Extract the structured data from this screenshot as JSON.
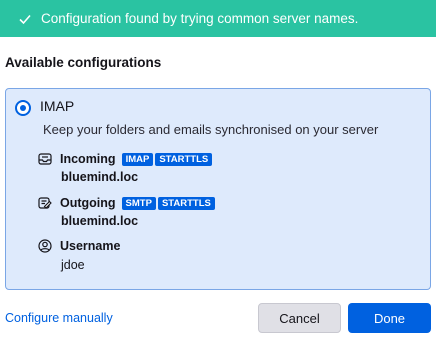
{
  "banner": {
    "text": "Configuration found by trying common server names.",
    "color": "#2ac3a2"
  },
  "section_title": "Available configurations",
  "config": {
    "protocol": "IMAP",
    "description": "Keep your folders and emails synchronised on your server",
    "selected": true,
    "incoming": {
      "label": "Incoming",
      "badges": [
        "IMAP",
        "STARTTLS"
      ],
      "host": "bluemind.loc",
      "icon": "inbox-icon"
    },
    "outgoing": {
      "label": "Outgoing",
      "badges": [
        "SMTP",
        "STARTTLS"
      ],
      "host": "bluemind.loc",
      "icon": "outbox-icon"
    },
    "username": {
      "label": "Username",
      "value": "jdoe",
      "icon": "user-icon"
    }
  },
  "footer": {
    "configure_manually": "Configure manually",
    "cancel_label": "Cancel",
    "done_label": "Done"
  },
  "colors": {
    "accent": "#0061e0",
    "card_bg": "#deeafc"
  }
}
